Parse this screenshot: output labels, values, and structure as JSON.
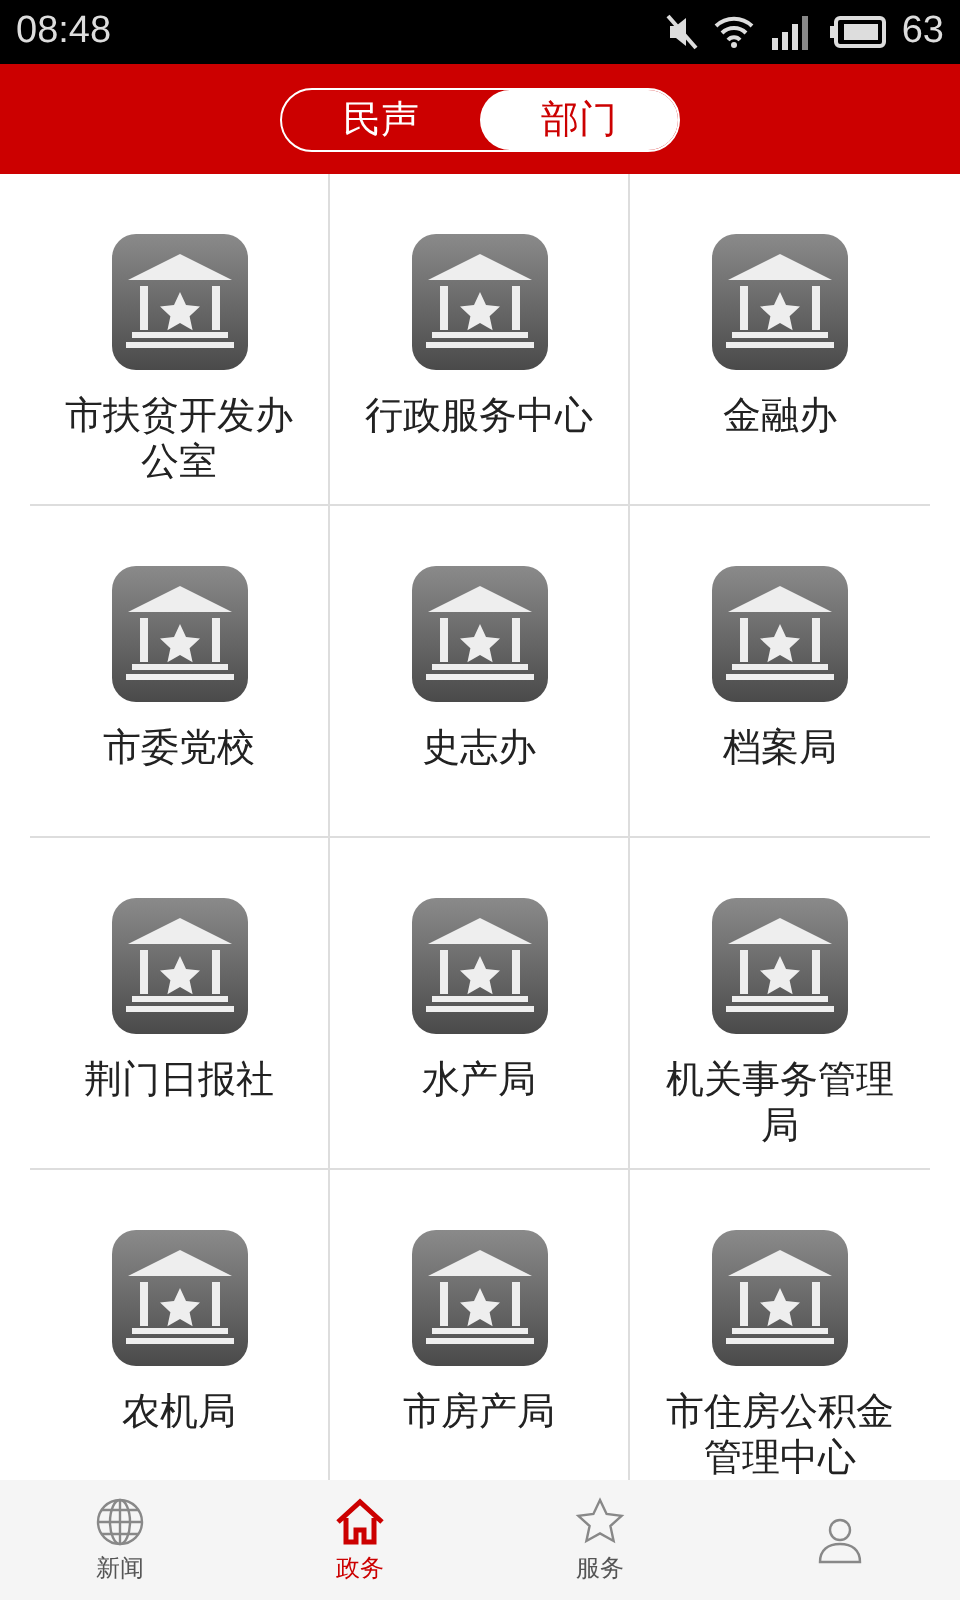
{
  "status_bar": {
    "time": "08:48",
    "battery": "63"
  },
  "segments": [
    {
      "label": "民声",
      "selected": false
    },
    {
      "label": "部门",
      "selected": true
    }
  ],
  "departments": [
    {
      "name": "市扶贫开发办公室"
    },
    {
      "name": "行政服务中心"
    },
    {
      "name": "金融办"
    },
    {
      "name": "市委党校"
    },
    {
      "name": "史志办"
    },
    {
      "name": "档案局"
    },
    {
      "name": "荆门日报社"
    },
    {
      "name": "水产局"
    },
    {
      "name": "机关事务管理局"
    },
    {
      "name": "农机局"
    },
    {
      "name": "市房产局"
    },
    {
      "name": "市住房公积金管理中心"
    }
  ],
  "bottom_nav": [
    {
      "kind": "globe",
      "label": "新闻",
      "selected": false
    },
    {
      "kind": "home",
      "label": "政务",
      "selected": true
    },
    {
      "kind": "star",
      "label": "服务",
      "selected": false
    },
    {
      "kind": "person",
      "selected": false
    }
  ]
}
